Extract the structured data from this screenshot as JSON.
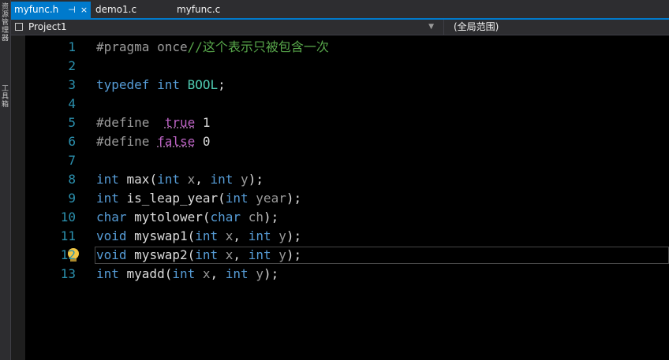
{
  "side_panel": {
    "labels": [
      "资源管理器",
      "工具箱"
    ]
  },
  "tabs": [
    {
      "label": "myfunc.h",
      "pin": "⊣",
      "close": "×",
      "active": true
    },
    {
      "label": "demo1.c",
      "active": false
    },
    {
      "label": "myfunc.c",
      "active": false
    }
  ],
  "nav": {
    "project": "Project1",
    "scope": "(全局范围)"
  },
  "editor": {
    "current_line": 12,
    "lines": [
      {
        "n": "1",
        "tokens": [
          [
            "mac",
            "#pragma once"
          ],
          [
            "cm",
            "//这个表示只被包含一次"
          ]
        ]
      },
      {
        "n": "2",
        "tokens": []
      },
      {
        "n": "3",
        "tokens": [
          [
            "k",
            "typedef "
          ],
          [
            "k",
            "int "
          ],
          [
            "typ",
            "BOOL"
          ],
          [
            "p",
            ";"
          ]
        ]
      },
      {
        "n": "4",
        "tokens": []
      },
      {
        "n": "5",
        "tokens": [
          [
            "mac",
            "#define  "
          ],
          [
            "macv",
            "true"
          ],
          [
            "p",
            " 1"
          ]
        ]
      },
      {
        "n": "6",
        "tokens": [
          [
            "mac",
            "#define "
          ],
          [
            "macv",
            "false"
          ],
          [
            "p",
            " 0"
          ]
        ]
      },
      {
        "n": "7",
        "tokens": []
      },
      {
        "n": "8",
        "tokens": [
          [
            "k",
            "int "
          ],
          [
            "fn",
            "max"
          ],
          [
            "p",
            "("
          ],
          [
            "k",
            "int "
          ],
          [
            "param",
            "x"
          ],
          [
            "p",
            ", "
          ],
          [
            "k",
            "int "
          ],
          [
            "param",
            "y"
          ],
          [
            "p",
            ");"
          ]
        ]
      },
      {
        "n": "9",
        "tokens": [
          [
            "k",
            "int "
          ],
          [
            "fn",
            "is_leap_year"
          ],
          [
            "p",
            "("
          ],
          [
            "k",
            "int "
          ],
          [
            "param",
            "year"
          ],
          [
            "p",
            ");"
          ]
        ]
      },
      {
        "n": "10",
        "tokens": [
          [
            "k",
            "char "
          ],
          [
            "fn",
            "mytolower"
          ],
          [
            "p",
            "("
          ],
          [
            "k",
            "char "
          ],
          [
            "param",
            "ch"
          ],
          [
            "p",
            ");"
          ]
        ]
      },
      {
        "n": "11",
        "tokens": [
          [
            "k",
            "void "
          ],
          [
            "fn",
            "myswap1"
          ],
          [
            "p",
            "("
          ],
          [
            "k",
            "int "
          ],
          [
            "param",
            "x"
          ],
          [
            "p",
            ", "
          ],
          [
            "k",
            "int "
          ],
          [
            "param",
            "y"
          ],
          [
            "p",
            ");"
          ]
        ]
      },
      {
        "n": "12",
        "tokens": [
          [
            "k",
            "void "
          ],
          [
            "fn",
            "myswap2"
          ],
          [
            "p",
            "("
          ],
          [
            "k",
            "int "
          ],
          [
            "param",
            "x"
          ],
          [
            "p",
            ", "
          ],
          [
            "k",
            "int "
          ],
          [
            "param",
            "y"
          ],
          [
            "p",
            ");"
          ]
        ]
      },
      {
        "n": "13",
        "tokens": [
          [
            "k",
            "int "
          ],
          [
            "fn",
            "myadd"
          ],
          [
            "p",
            "("
          ],
          [
            "k",
            "int "
          ],
          [
            "param",
            "x"
          ],
          [
            "p",
            ", "
          ],
          [
            "k",
            "int "
          ],
          [
            "param",
            "y"
          ],
          [
            "p",
            ");"
          ]
        ]
      }
    ]
  },
  "colors": {
    "accent": "#007acc",
    "line_number": "#2b91af",
    "keyword": "#569cd6",
    "comment": "#57a64a",
    "macro": "#bd63c5",
    "type": "#4ec9b0"
  }
}
